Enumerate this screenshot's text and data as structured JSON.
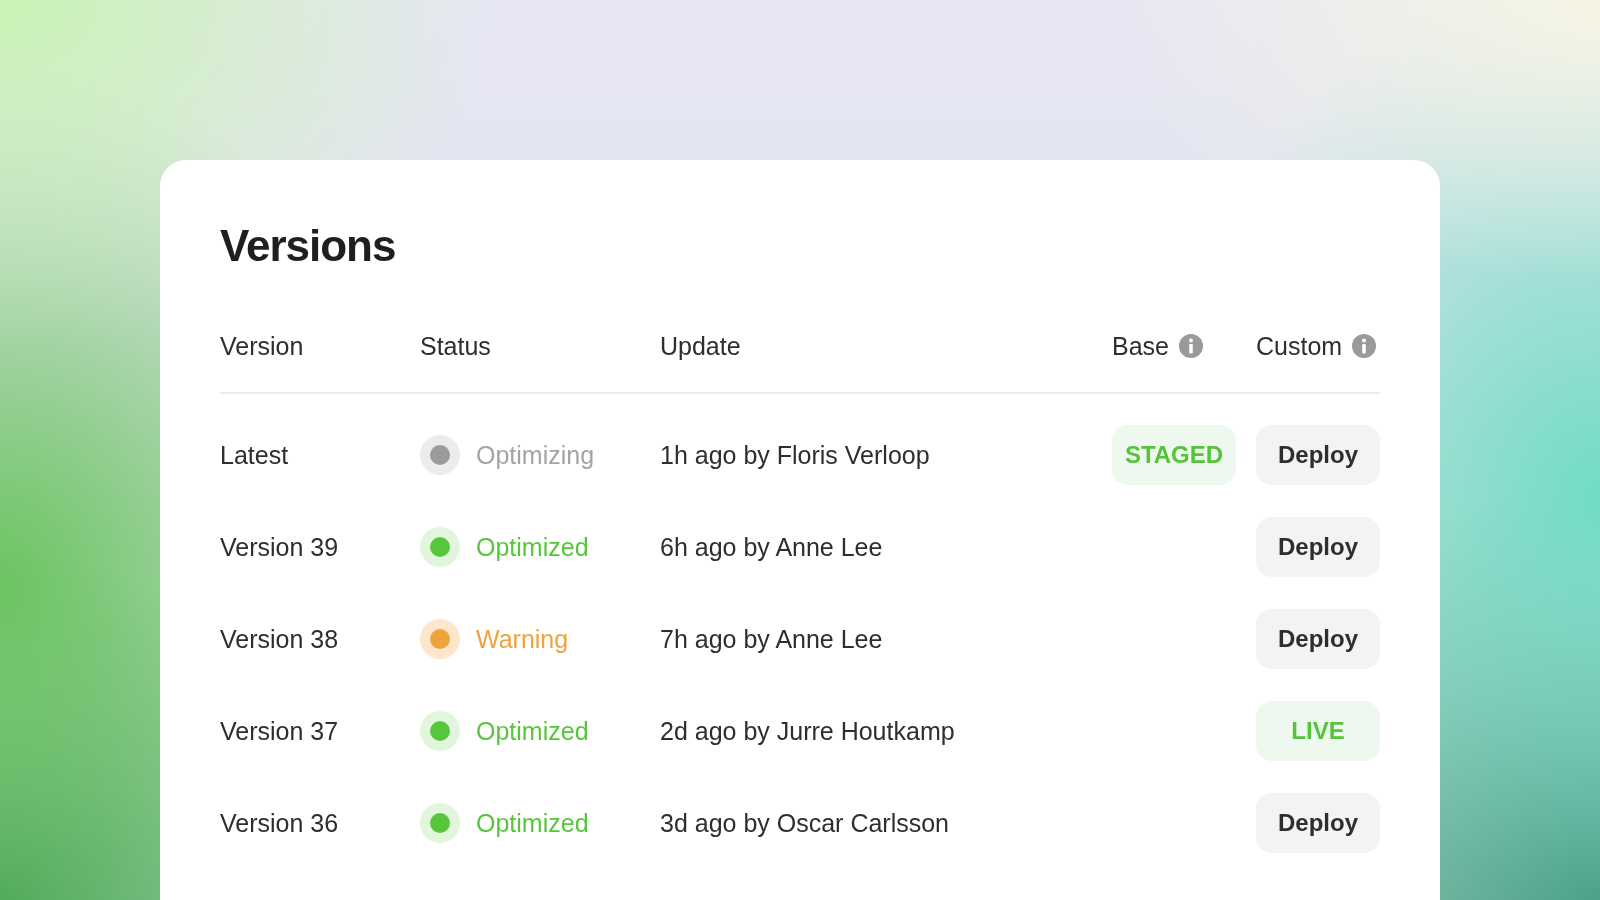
{
  "title": "Versions",
  "table": {
    "columns": [
      {
        "label": "Version",
        "info": false
      },
      {
        "label": "Status",
        "info": false
      },
      {
        "label": "Update",
        "info": false
      },
      {
        "label": "Base",
        "info": true
      },
      {
        "label": "Custom",
        "info": true
      }
    ],
    "rows": [
      {
        "version": "Latest",
        "status": {
          "kind": "optimizing",
          "label": "Optimizing"
        },
        "update": "1h ago by Floris Verloop",
        "base": {
          "kind": "badge",
          "label": "STAGED"
        },
        "custom": {
          "kind": "button",
          "label": "Deploy"
        }
      },
      {
        "version": "Version 39",
        "status": {
          "kind": "optimized",
          "label": "Optimized"
        },
        "update": "6h ago by Anne Lee",
        "custom": {
          "kind": "button",
          "label": "Deploy"
        }
      },
      {
        "version": "Version 38",
        "status": {
          "kind": "warning",
          "label": "Warning"
        },
        "update": "7h ago by Anne Lee",
        "custom": {
          "kind": "button",
          "label": "Deploy"
        }
      },
      {
        "version": "Version 37",
        "status": {
          "kind": "optimized",
          "label": "Optimized"
        },
        "update": "2d ago by Jurre Houtkamp",
        "custom": {
          "kind": "badge",
          "label": "LIVE"
        }
      },
      {
        "version": "Version 36",
        "status": {
          "kind": "optimized",
          "label": "Optimized"
        },
        "update": "3d ago by Oscar Carlsson",
        "custom": {
          "kind": "button",
          "label": "Deploy"
        }
      }
    ]
  }
}
